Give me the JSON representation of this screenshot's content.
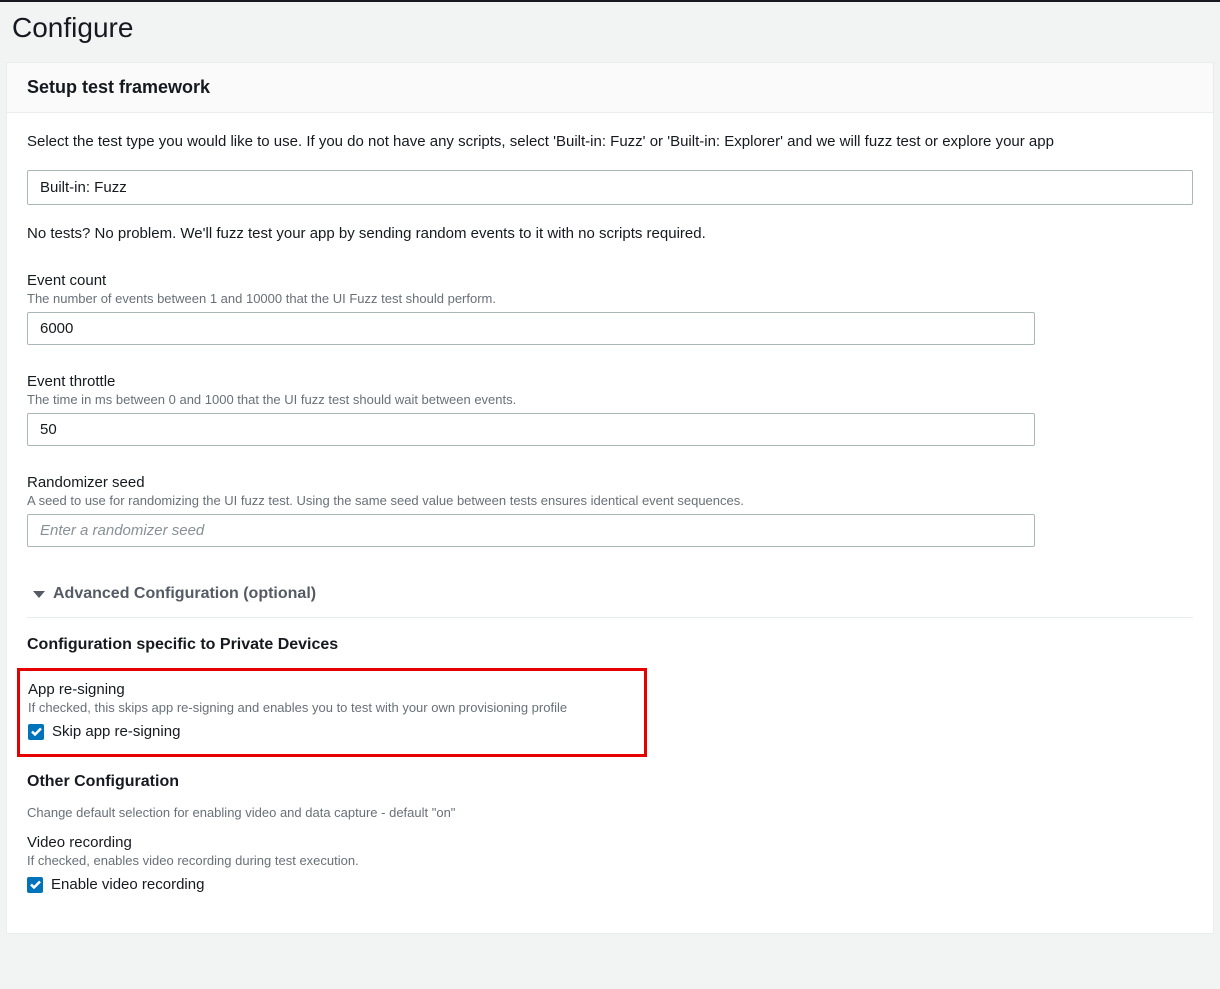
{
  "page": {
    "title": "Configure"
  },
  "card": {
    "header": "Setup test framework",
    "intro": "Select the test type you would like to use. If you do not have any scripts, select 'Built-in: Fuzz' or 'Built-in: Explorer' and we will fuzz test or explore your app",
    "test_type_value": "Built-in: Fuzz",
    "hint": "No tests? No problem. We'll fuzz test your app by sending random events to it with no scripts required."
  },
  "fields": {
    "event_count": {
      "label": "Event count",
      "desc": "The number of events between 1 and 10000 that the UI Fuzz test should perform.",
      "value": "6000"
    },
    "event_throttle": {
      "label": "Event throttle",
      "desc": "The time in ms between 0 and 1000 that the UI fuzz test should wait between events.",
      "value": "50"
    },
    "randomizer_seed": {
      "label": "Randomizer seed",
      "desc": "A seed to use for randomizing the UI fuzz test. Using the same seed value between tests ensures identical event sequences.",
      "placeholder": "Enter a randomizer seed",
      "value": ""
    }
  },
  "advanced": {
    "toggle_label": "Advanced Configuration (optional)",
    "private_devices": {
      "heading": "Configuration specific to Private Devices",
      "app_resigning": {
        "label": "App re-signing",
        "desc": "If checked, this skips app re-signing and enables you to test with your own provisioning profile",
        "checkbox_label": "Skip app re-signing",
        "checked": true
      }
    },
    "other": {
      "heading": "Other Configuration",
      "desc": "Change default selection for enabling video and data capture - default \"on\"",
      "video_recording": {
        "label": "Video recording",
        "desc": "If checked, enables video recording during test execution.",
        "checkbox_label": "Enable video recording",
        "checked": true
      }
    }
  },
  "colors": {
    "accent": "#0073bb",
    "highlight_border": "#e60000"
  }
}
